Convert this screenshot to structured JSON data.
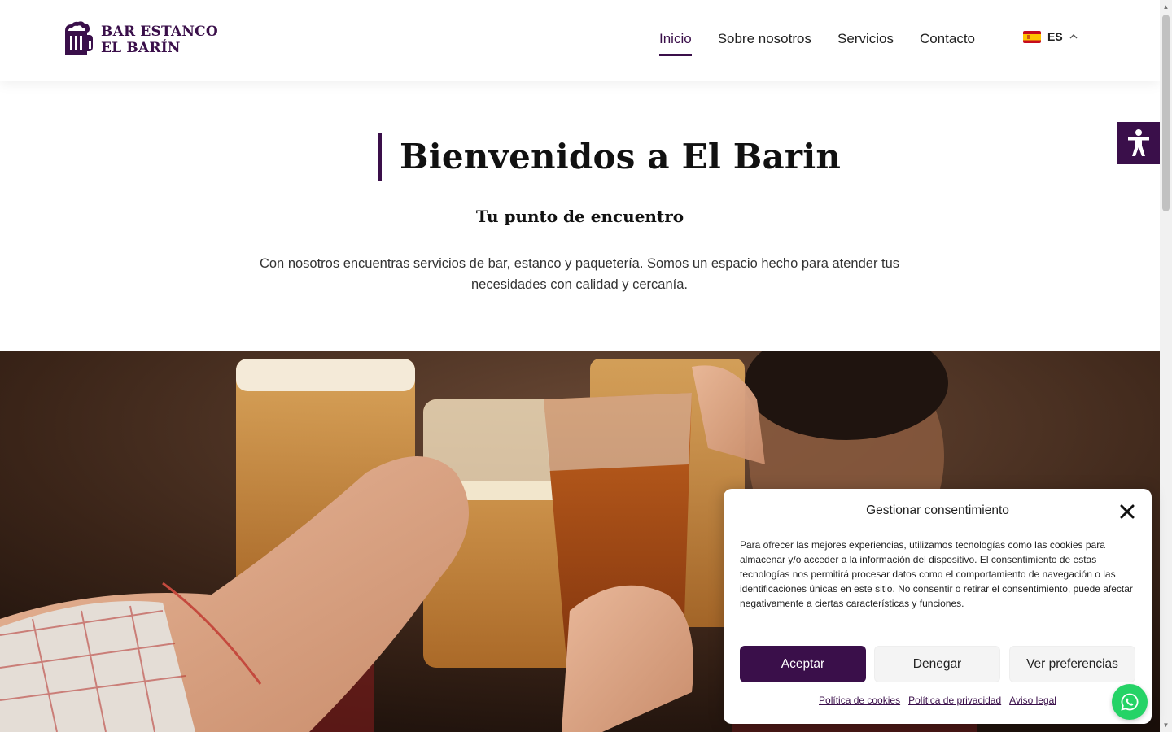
{
  "header": {
    "logo": {
      "line1": "BAR ESTANCO",
      "line2": "EL BARÍN"
    },
    "nav": [
      {
        "label": "Inicio",
        "active": true
      },
      {
        "label": "Sobre nosotros",
        "active": false
      },
      {
        "label": "Servicios",
        "active": false
      },
      {
        "label": "Contacto",
        "active": false
      }
    ],
    "language": {
      "code": "ES",
      "flag_icon": "spain-flag-icon",
      "chevron_icon": "chevron-up-icon"
    }
  },
  "hero": {
    "title": "Bienvenidos a El Barin",
    "subtitle": "Tu punto de encuentro",
    "intro": "Con nosotros encuentras servicios de bar, estanco y paquetería. Somos un espacio hecho para atender tus necesidades con calidad y cercanía."
  },
  "cookie_modal": {
    "title": "Gestionar consentimiento",
    "text": "Para ofrecer las mejores experiencias, utilizamos tecnologías como las cookies para almacenar y/o acceder a la información del dispositivo. El consentimiento de estas tecnologías nos permitirá procesar datos como el comportamiento de navegación o las identificaciones únicas en este sitio. No consentir o retirar el consentimiento, puede afectar negativamente a ciertas características y funciones.",
    "buttons": {
      "accept": "Aceptar",
      "deny": "Denegar",
      "preferences": "Ver preferencias"
    },
    "links": [
      "Política de cookies",
      "Política de privacidad",
      "Aviso legal"
    ]
  },
  "colors": {
    "brand": "#3a0f4a",
    "whatsapp": "#25d366"
  },
  "icons": {
    "accessibility": "accessibility-icon",
    "whatsapp": "whatsapp-icon",
    "close": "close-icon"
  }
}
